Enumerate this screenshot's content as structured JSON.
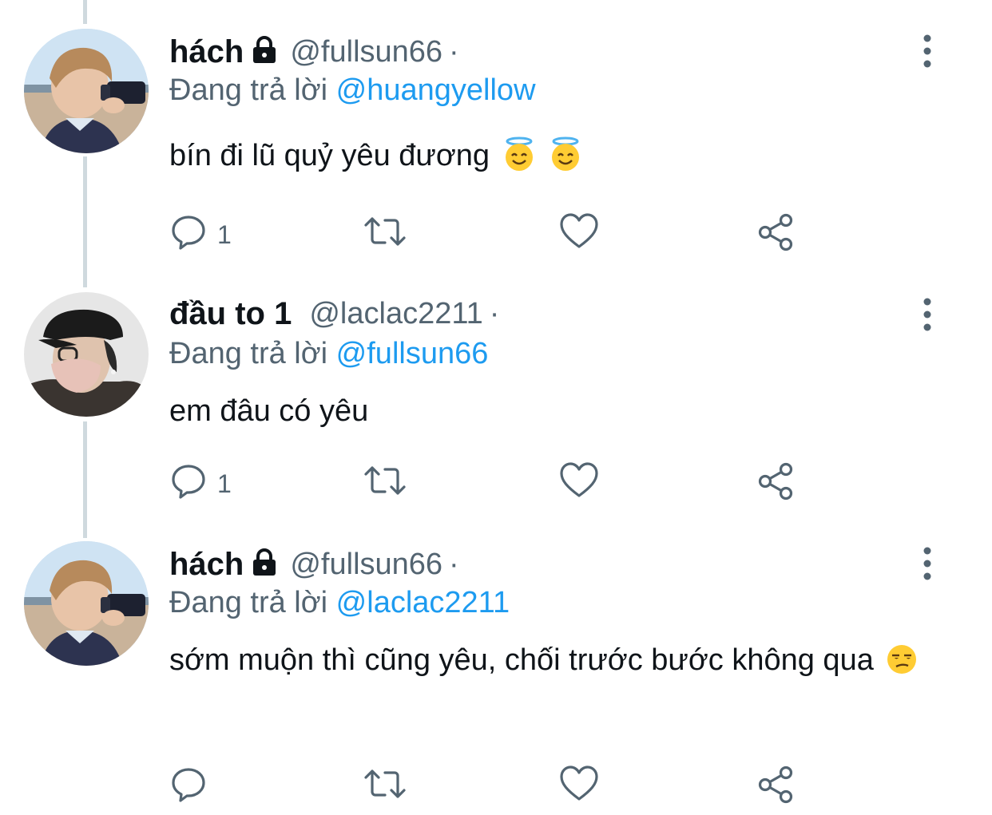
{
  "tweets": [
    {
      "name": "hách",
      "handle": "@fullsun66",
      "separator": "·",
      "reply_prefix": "Đang trả lời",
      "reply_to": "@huangyellow",
      "text": "bín đi lũ quỷ yêu đương",
      "emoji": [
        "smiling-face-with-halo",
        "smiling-face-with-halo"
      ],
      "reply_count": "1",
      "avatar": "beach-camera-avatar"
    },
    {
      "name": "đầu to 1",
      "handle": "@laclac2211",
      "separator": "·",
      "reply_prefix": "Đang trả lời",
      "reply_to": "@fullsun66",
      "text": "em đâu có yêu",
      "emoji": [],
      "reply_count": "1",
      "avatar": "cap-mask-avatar"
    },
    {
      "name": "hách",
      "handle": "@fullsun66",
      "separator": "·",
      "reply_prefix": "Đang trả lời",
      "reply_to": "@laclac2211",
      "text": "sớm muộn thì cũng yêu, chối trước bước không qua",
      "emoji": [
        "unamused-face"
      ],
      "reply_count": "",
      "avatar": "beach-camera-avatar"
    }
  ],
  "colors": {
    "text": "#0f1419",
    "secondary": "#536471",
    "link": "#1d9bf0",
    "thread_line": "#cfd9de"
  },
  "icons": [
    "comment-icon",
    "retweet-icon",
    "like-icon",
    "share-icon",
    "more-icon",
    "lock-icon"
  ]
}
